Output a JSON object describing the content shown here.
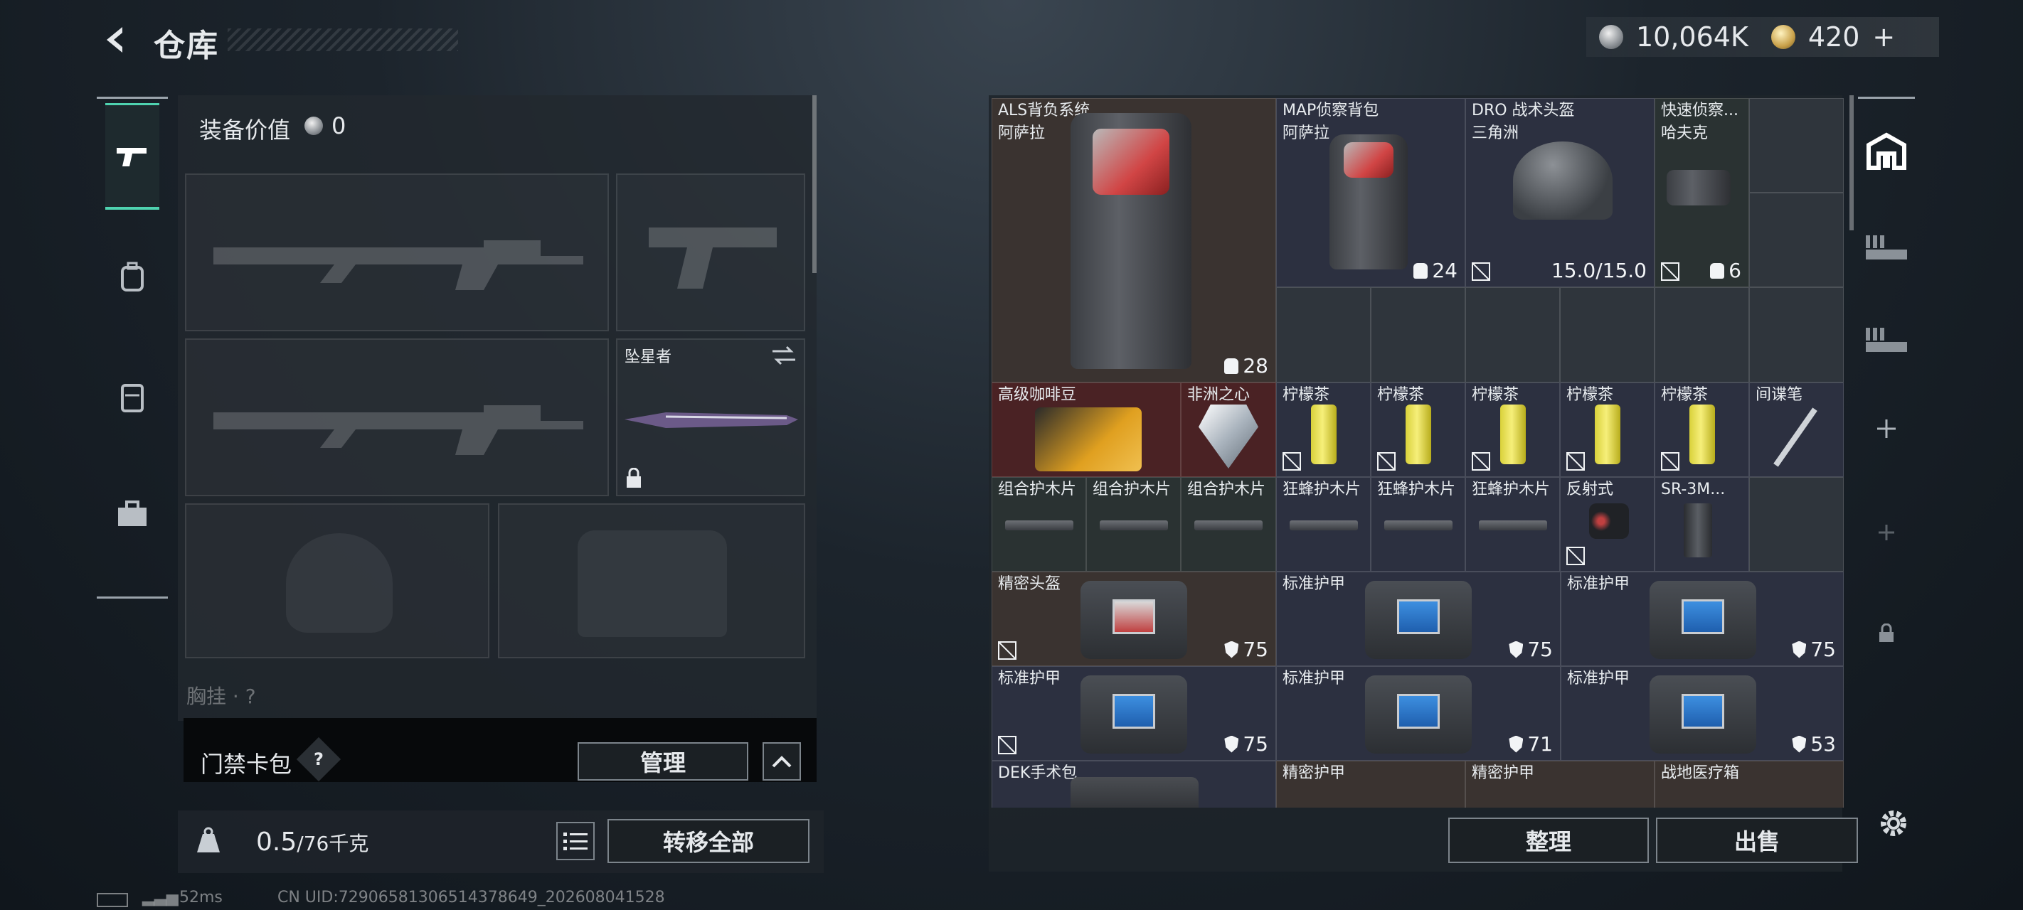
{
  "header": {
    "title": "仓库",
    "currency_silver": "10,064K",
    "currency_gold": "420",
    "currency_gold_plus": "+"
  },
  "left_nav": {
    "items": [
      "pistol-icon",
      "backpack-icon",
      "vest-icon",
      "case-icon"
    ],
    "active": 0
  },
  "equipment": {
    "value_label": "装备价值",
    "value": "0",
    "melee_name": "坠星者",
    "chest_label": "胸挂 · ?"
  },
  "keycard": {
    "label": "门禁卡包",
    "help": "?",
    "manage": "管理"
  },
  "weight": {
    "current": "0.5",
    "max": "/76",
    "unit": "千克",
    "transfer": "转移全部"
  },
  "status": {
    "ping": "52ms",
    "uid": "CN UID:729065813065143786​49_202608041528"
  },
  "stash": {
    "items": [
      {
        "name": "ALS背负系统",
        "sub": "阿萨拉",
        "stat": "28"
      },
      {
        "name": "MAP侦察背包",
        "sub": "阿萨拉",
        "stat": "24"
      },
      {
        "name": "DRO 战术头盔",
        "sub": "三角洲",
        "stat": "15.0/15.0"
      },
      {
        "name": "快速侦察...",
        "sub": "哈夫克",
        "stat": "6"
      },
      {
        "name": "高级咖啡豆"
      },
      {
        "name": "非洲之心"
      },
      {
        "name": "柠檬茶"
      },
      {
        "name": "柠檬茶"
      },
      {
        "name": "柠檬茶"
      },
      {
        "name": "柠檬茶"
      },
      {
        "name": "柠檬茶"
      },
      {
        "name": "间谍笔"
      },
      {
        "name": "组合护木片"
      },
      {
        "name": "组合护木片"
      },
      {
        "name": "组合护木片"
      },
      {
        "name": "狂蜂护木片"
      },
      {
        "name": "狂蜂护木片"
      },
      {
        "name": "狂蜂护木片"
      },
      {
        "name": "反射式"
      },
      {
        "name": "SR-3M..."
      },
      {
        "name": "精密头盔",
        "stat": "75"
      },
      {
        "name": "标准护甲",
        "stat": "75"
      },
      {
        "name": "标准护甲",
        "stat": "75"
      },
      {
        "name": "标准护甲",
        "stat": "75"
      },
      {
        "name": "标准护甲",
        "stat": "71"
      },
      {
        "name": "标准护甲",
        "stat": "53"
      },
      {
        "name": "DEK手术包"
      },
      {
        "name": "精密护甲"
      },
      {
        "name": "精密护甲"
      },
      {
        "name": "战地医疗箱"
      }
    ],
    "sort": "整理",
    "sell": "出售"
  },
  "right_nav": {
    "items": [
      "stash-icon",
      "stash-tab-iii-1",
      "stash-tab-iii-2",
      "add-tab-plus",
      "add-tab-plus-dim",
      "lock-icon"
    ]
  },
  "colors": {
    "accent": "#4fd3b0",
    "panel": "#2b3138"
  }
}
